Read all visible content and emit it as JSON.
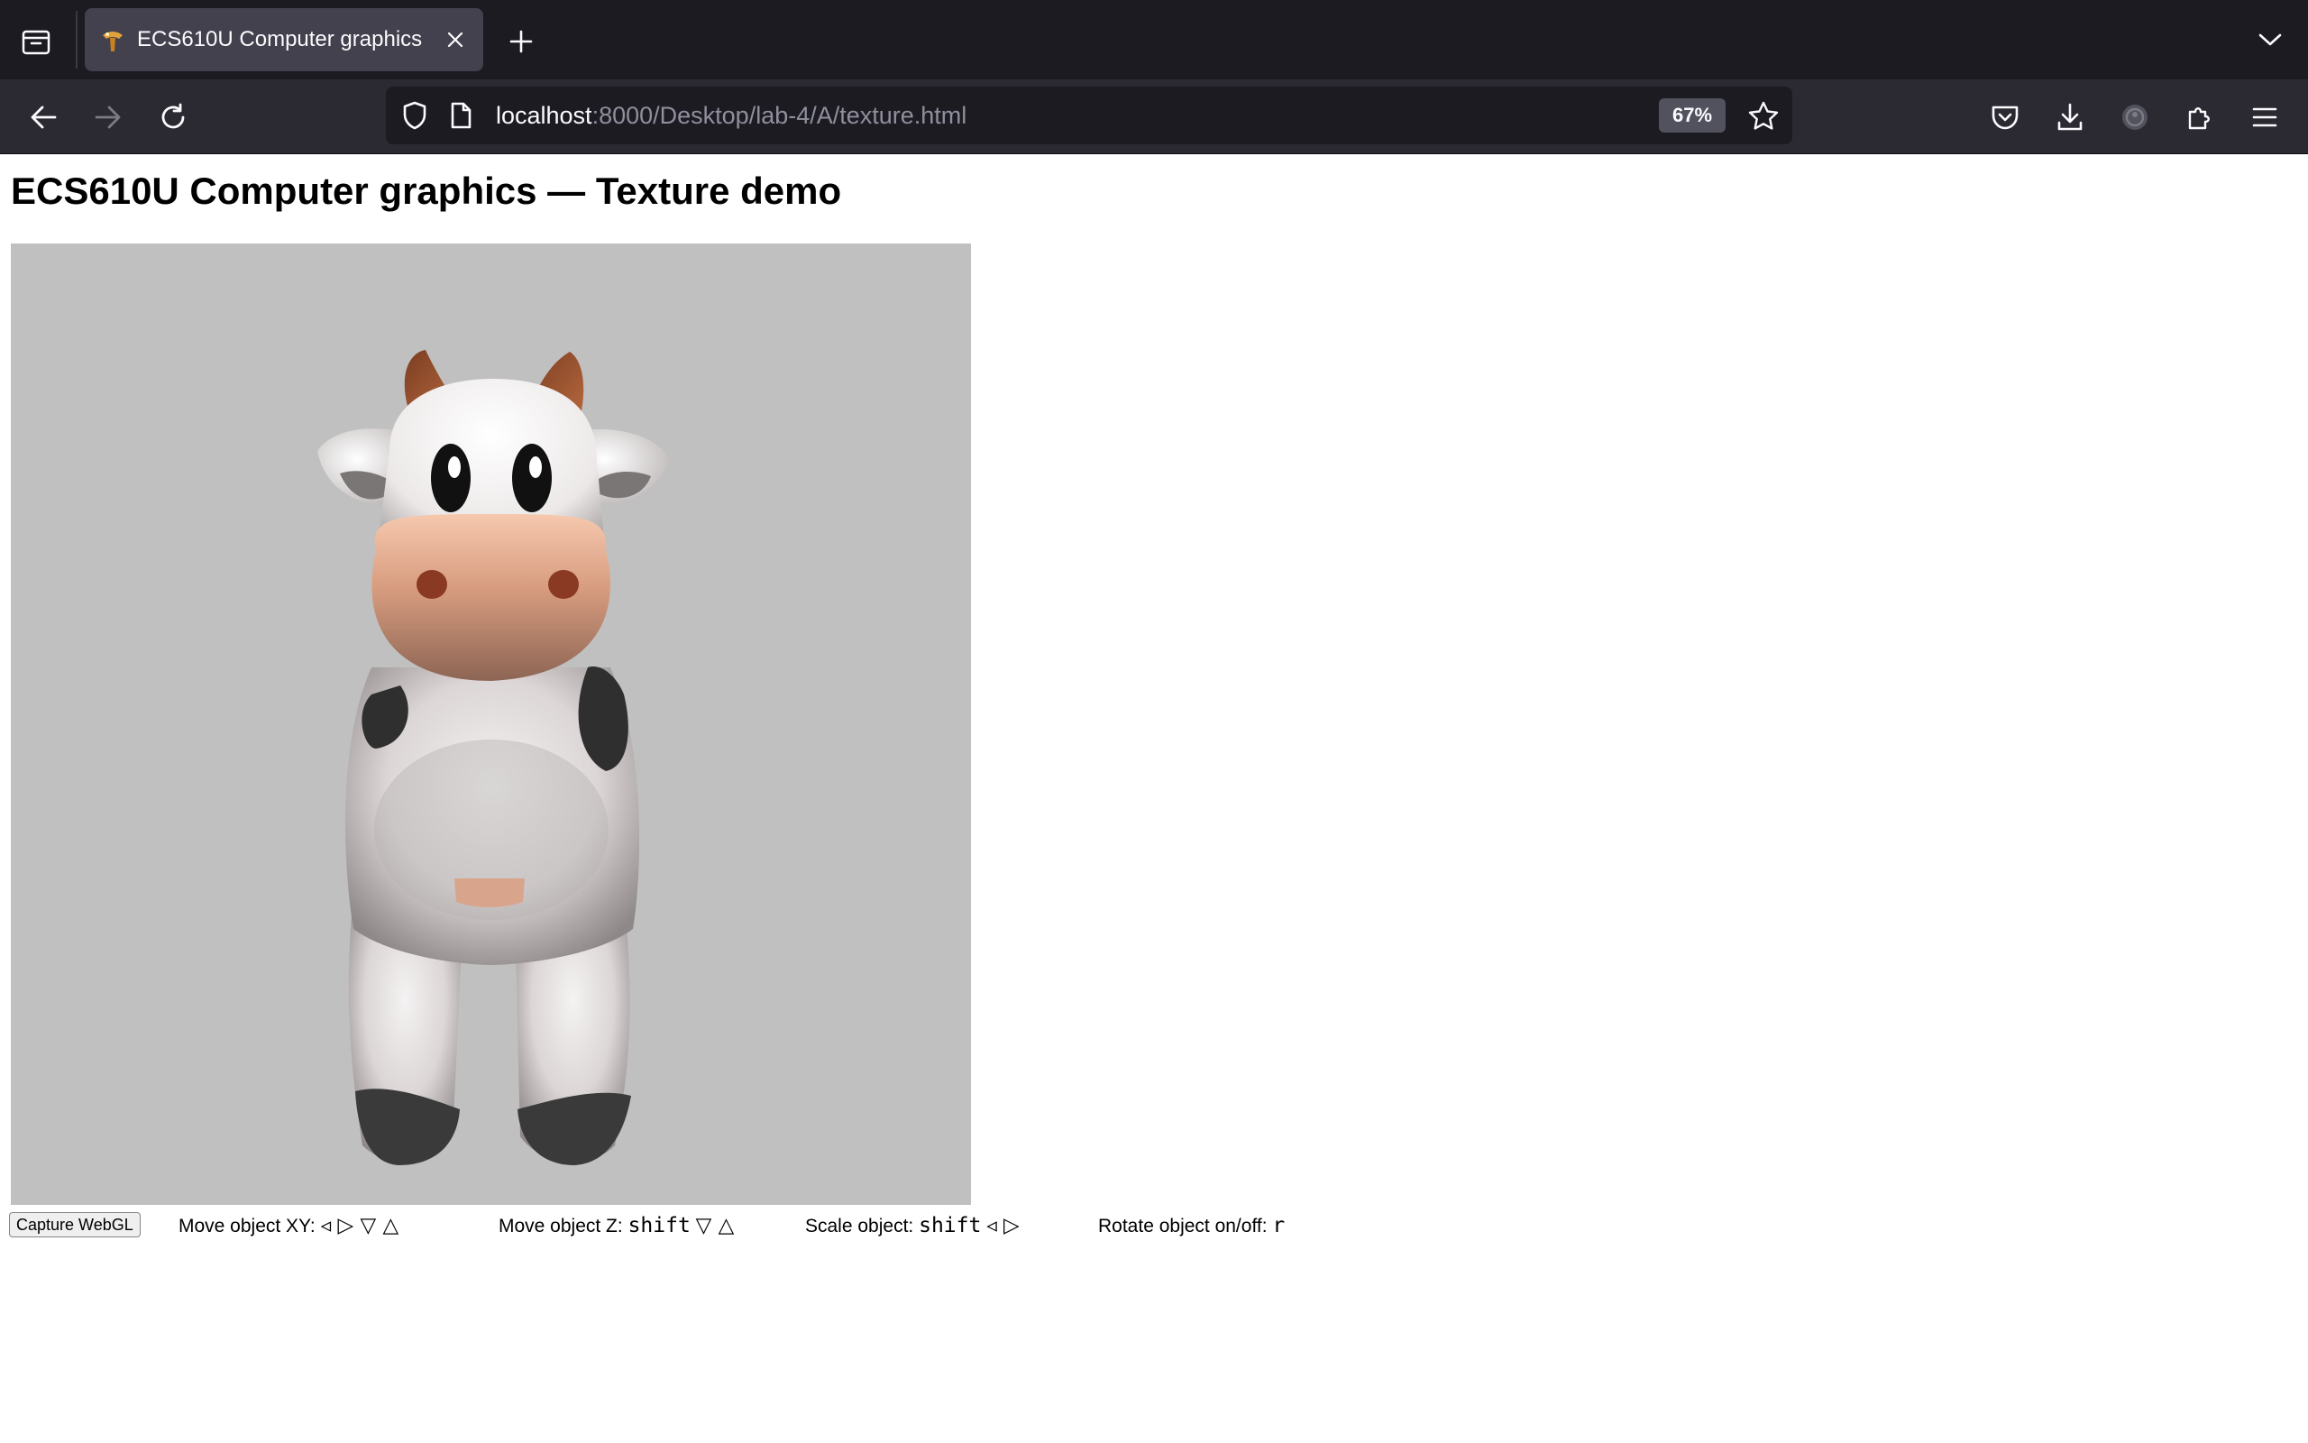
{
  "browser": {
    "tab_title": "ECS610U Computer graphics",
    "url_host": "localhost",
    "url_rest": ":8000/Desktop/lab-4/A/texture.html",
    "zoom": "67%"
  },
  "page": {
    "title": "ECS610U Computer graphics — Texture demo",
    "canvas_background": "#c0c0c0"
  },
  "controls": {
    "capture_button": "Capture WebGL",
    "move_xy_label": "Move object XY:",
    "move_xy_keys": "◃ ▷ ▽ △",
    "move_z_label": "Move object Z:",
    "move_z_mod": "shift",
    "move_z_keys": "▽ △",
    "scale_label": "Scale object:",
    "scale_mod": "shift",
    "scale_keys": "◃ ▷",
    "rotate_label": "Rotate object on/off:",
    "rotate_key": "r"
  }
}
